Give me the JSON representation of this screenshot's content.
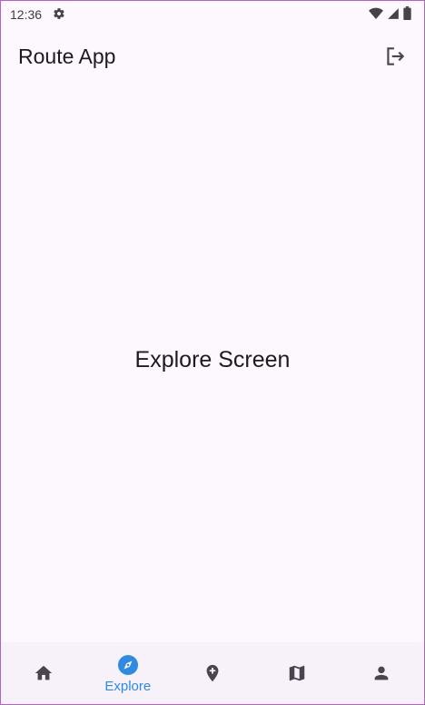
{
  "status_bar": {
    "time": "12:36",
    "icons": [
      "settings-icon",
      "wifi-icon",
      "signal-icon",
      "battery-icon"
    ]
  },
  "app_bar": {
    "title": "Route App",
    "action_icon": "logout-icon"
  },
  "main": {
    "screen_label": "Explore Screen"
  },
  "bottom_nav": {
    "active_index": 1,
    "items": [
      {
        "icon": "home-icon",
        "label": ""
      },
      {
        "icon": "compass-icon",
        "label": "Explore"
      },
      {
        "icon": "add-location-icon",
        "label": ""
      },
      {
        "icon": "map-icon",
        "label": ""
      },
      {
        "icon": "person-icon",
        "label": ""
      }
    ]
  },
  "colors": {
    "background": "#fdf7fe",
    "nav_background": "#f7f1fa",
    "active": "#2f8ae0",
    "inactive_icon": "#48454e",
    "text": "#1d1b20"
  }
}
